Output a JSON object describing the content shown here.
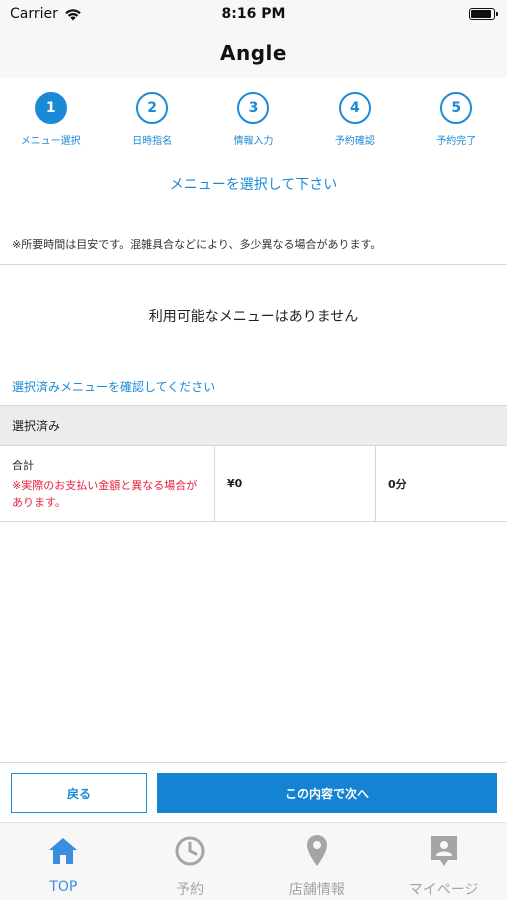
{
  "status_bar": {
    "carrier": "Carrier",
    "time": "8:16 PM"
  },
  "nav": {
    "title": "Angle"
  },
  "steps": [
    {
      "number": "1",
      "label": "メニュー選択"
    },
    {
      "number": "2",
      "label": "日時指名"
    },
    {
      "number": "3",
      "label": "情報入力"
    },
    {
      "number": "4",
      "label": "予約確認"
    },
    {
      "number": "5",
      "label": "予約完了"
    }
  ],
  "main": {
    "section_title": "メニューを選択して下さい",
    "note": "※所要時間は目安です。混雑具合などにより、多少異なる場合があります。",
    "empty_message": "利用可能なメニューはありません",
    "confirm_link": "選択済みメニューを確認してください"
  },
  "selected": {
    "header": "選択済み",
    "total_label": "合計",
    "warning": "※実際のお支払い金額と異なる場合があります。",
    "price": "¥0",
    "duration": "0分"
  },
  "buttons": {
    "back": "戻る",
    "next": "この内容で次へ"
  },
  "tabs": [
    {
      "label": "TOP",
      "icon": "home-icon"
    },
    {
      "label": "予約",
      "icon": "clock-icon"
    },
    {
      "label": "店舗情報",
      "icon": "map-pin-icon"
    },
    {
      "label": "マイページ",
      "icon": "person-badge-icon"
    }
  ],
  "colors": {
    "accent": "#1b8ad6",
    "warning": "#e8213d",
    "tab_active": "#3a8de0",
    "tab_inactive": "#a5a5a5"
  }
}
